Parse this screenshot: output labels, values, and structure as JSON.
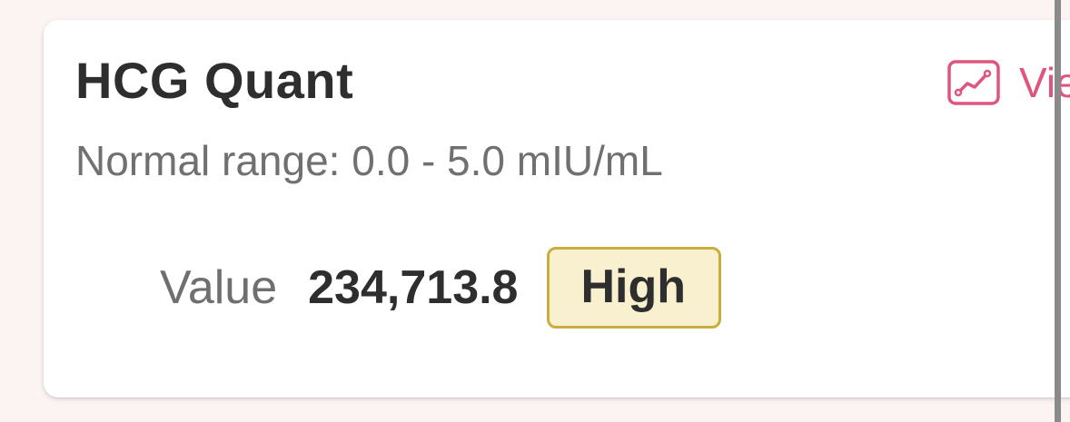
{
  "card": {
    "title": "HCG Quant",
    "normal_range": "Normal range: 0.0 - 5.0 mIU/mL",
    "value_label": "Value",
    "value": "234,713.8",
    "status": "High",
    "view_link_text": "Vie",
    "view_icon": "trend-chart-icon"
  },
  "colors": {
    "accent": "#e0557e",
    "badge_bg": "#f9f0cf",
    "badge_border": "#c9ad3d",
    "page_bg": "#fcf3f3"
  }
}
